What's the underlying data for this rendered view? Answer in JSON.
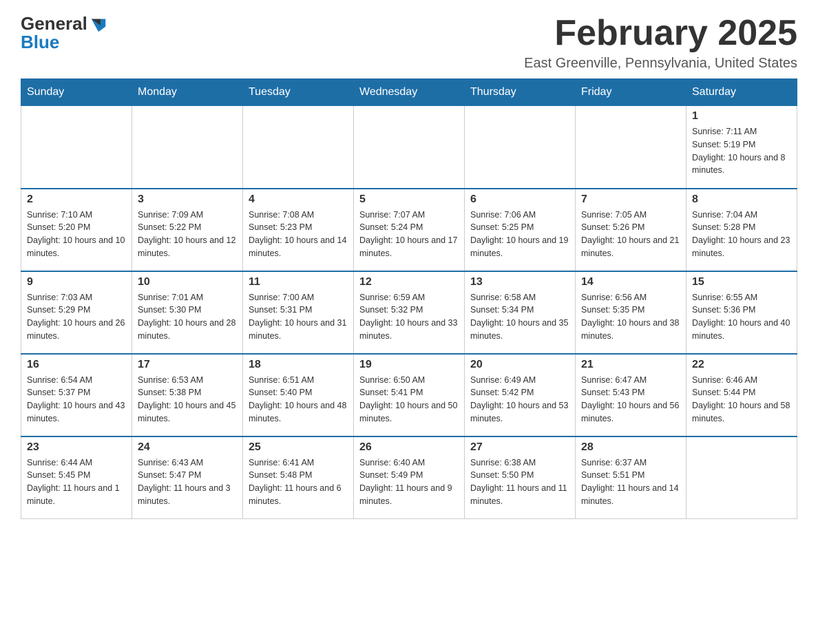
{
  "header": {
    "logo_general": "General",
    "logo_blue": "Blue",
    "month_year": "February 2025",
    "location": "East Greenville, Pennsylvania, United States"
  },
  "weekdays": [
    "Sunday",
    "Monday",
    "Tuesday",
    "Wednesday",
    "Thursday",
    "Friday",
    "Saturday"
  ],
  "weeks": [
    {
      "days": [
        {
          "number": "",
          "info": ""
        },
        {
          "number": "",
          "info": ""
        },
        {
          "number": "",
          "info": ""
        },
        {
          "number": "",
          "info": ""
        },
        {
          "number": "",
          "info": ""
        },
        {
          "number": "",
          "info": ""
        },
        {
          "number": "1",
          "info": "Sunrise: 7:11 AM\nSunset: 5:19 PM\nDaylight: 10 hours and 8 minutes."
        }
      ]
    },
    {
      "days": [
        {
          "number": "2",
          "info": "Sunrise: 7:10 AM\nSunset: 5:20 PM\nDaylight: 10 hours and 10 minutes."
        },
        {
          "number": "3",
          "info": "Sunrise: 7:09 AM\nSunset: 5:22 PM\nDaylight: 10 hours and 12 minutes."
        },
        {
          "number": "4",
          "info": "Sunrise: 7:08 AM\nSunset: 5:23 PM\nDaylight: 10 hours and 14 minutes."
        },
        {
          "number": "5",
          "info": "Sunrise: 7:07 AM\nSunset: 5:24 PM\nDaylight: 10 hours and 17 minutes."
        },
        {
          "number": "6",
          "info": "Sunrise: 7:06 AM\nSunset: 5:25 PM\nDaylight: 10 hours and 19 minutes."
        },
        {
          "number": "7",
          "info": "Sunrise: 7:05 AM\nSunset: 5:26 PM\nDaylight: 10 hours and 21 minutes."
        },
        {
          "number": "8",
          "info": "Sunrise: 7:04 AM\nSunset: 5:28 PM\nDaylight: 10 hours and 23 minutes."
        }
      ]
    },
    {
      "days": [
        {
          "number": "9",
          "info": "Sunrise: 7:03 AM\nSunset: 5:29 PM\nDaylight: 10 hours and 26 minutes."
        },
        {
          "number": "10",
          "info": "Sunrise: 7:01 AM\nSunset: 5:30 PM\nDaylight: 10 hours and 28 minutes."
        },
        {
          "number": "11",
          "info": "Sunrise: 7:00 AM\nSunset: 5:31 PM\nDaylight: 10 hours and 31 minutes."
        },
        {
          "number": "12",
          "info": "Sunrise: 6:59 AM\nSunset: 5:32 PM\nDaylight: 10 hours and 33 minutes."
        },
        {
          "number": "13",
          "info": "Sunrise: 6:58 AM\nSunset: 5:34 PM\nDaylight: 10 hours and 35 minutes."
        },
        {
          "number": "14",
          "info": "Sunrise: 6:56 AM\nSunset: 5:35 PM\nDaylight: 10 hours and 38 minutes."
        },
        {
          "number": "15",
          "info": "Sunrise: 6:55 AM\nSunset: 5:36 PM\nDaylight: 10 hours and 40 minutes."
        }
      ]
    },
    {
      "days": [
        {
          "number": "16",
          "info": "Sunrise: 6:54 AM\nSunset: 5:37 PM\nDaylight: 10 hours and 43 minutes."
        },
        {
          "number": "17",
          "info": "Sunrise: 6:53 AM\nSunset: 5:38 PM\nDaylight: 10 hours and 45 minutes."
        },
        {
          "number": "18",
          "info": "Sunrise: 6:51 AM\nSunset: 5:40 PM\nDaylight: 10 hours and 48 minutes."
        },
        {
          "number": "19",
          "info": "Sunrise: 6:50 AM\nSunset: 5:41 PM\nDaylight: 10 hours and 50 minutes."
        },
        {
          "number": "20",
          "info": "Sunrise: 6:49 AM\nSunset: 5:42 PM\nDaylight: 10 hours and 53 minutes."
        },
        {
          "number": "21",
          "info": "Sunrise: 6:47 AM\nSunset: 5:43 PM\nDaylight: 10 hours and 56 minutes."
        },
        {
          "number": "22",
          "info": "Sunrise: 6:46 AM\nSunset: 5:44 PM\nDaylight: 10 hours and 58 minutes."
        }
      ]
    },
    {
      "days": [
        {
          "number": "23",
          "info": "Sunrise: 6:44 AM\nSunset: 5:45 PM\nDaylight: 11 hours and 1 minute."
        },
        {
          "number": "24",
          "info": "Sunrise: 6:43 AM\nSunset: 5:47 PM\nDaylight: 11 hours and 3 minutes."
        },
        {
          "number": "25",
          "info": "Sunrise: 6:41 AM\nSunset: 5:48 PM\nDaylight: 11 hours and 6 minutes."
        },
        {
          "number": "26",
          "info": "Sunrise: 6:40 AM\nSunset: 5:49 PM\nDaylight: 11 hours and 9 minutes."
        },
        {
          "number": "27",
          "info": "Sunrise: 6:38 AM\nSunset: 5:50 PM\nDaylight: 11 hours and 11 minutes."
        },
        {
          "number": "28",
          "info": "Sunrise: 6:37 AM\nSunset: 5:51 PM\nDaylight: 11 hours and 14 minutes."
        },
        {
          "number": "",
          "info": ""
        }
      ]
    }
  ]
}
